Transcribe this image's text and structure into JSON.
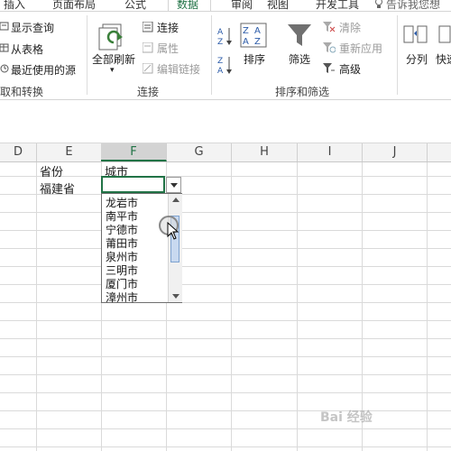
{
  "tabs": [
    "插入",
    "页面布局",
    "公式",
    "数据",
    "审阅",
    "视图",
    "开发工具",
    "告诉我您想"
  ],
  "active_tab": "数据",
  "ribbon": {
    "get_transform": {
      "items": [
        "显示查询",
        "从表格",
        "最近使用的源"
      ],
      "label": "取和转换"
    },
    "connections": {
      "refresh_all": "全部刷新",
      "items": [
        "连接",
        "属性",
        "编辑链接"
      ],
      "label": "连接"
    },
    "sort_filter": {
      "sort": "排序",
      "filter": "筛选",
      "items": [
        "清除",
        "重新应用",
        "高级"
      ],
      "label": "排序和筛选"
    },
    "data_tools": {
      "split": "分列",
      "quick": "快速"
    }
  },
  "columns": [
    "D",
    "E",
    "F",
    "G",
    "H",
    "I",
    "J"
  ],
  "selected_column": "F",
  "cells": {
    "e1": "省份",
    "f1": "城市",
    "e2": "福建省"
  },
  "dropdown": {
    "options": [
      "龙岩市",
      "南平市",
      "宁德市",
      "莆田市",
      "泉州市",
      "三明市",
      "厦门市",
      "漳州市"
    ]
  },
  "watermark": "Bai 经验"
}
